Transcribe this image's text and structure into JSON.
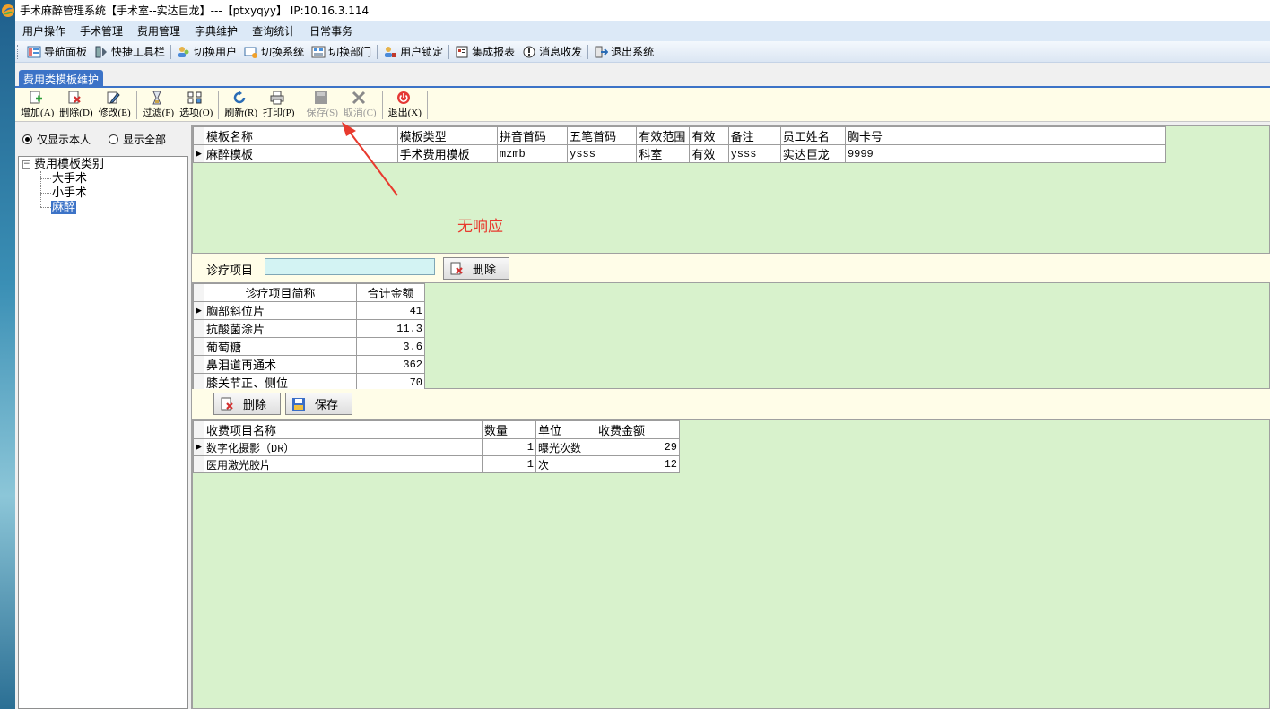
{
  "window": {
    "title": "手术麻醉管理系统【手术室--实达巨龙】---【ptxyqyy】 IP:10.16.3.114"
  },
  "menubar": {
    "items": [
      "用户操作",
      "手术管理",
      "费用管理",
      "字典维护",
      "查询统计",
      "日常事务"
    ]
  },
  "toolbar1": {
    "items": [
      {
        "label": "导航面板",
        "icon": "navigation-panel-icon"
      },
      {
        "label": "快捷工具栏",
        "icon": "quick-toolbar-icon"
      },
      {
        "label": "切换用户",
        "icon": "switch-user-icon"
      },
      {
        "label": "切换系统",
        "icon": "switch-system-icon"
      },
      {
        "label": "切换部门",
        "icon": "switch-department-icon"
      },
      {
        "label": "用户锁定",
        "icon": "user-lock-icon"
      },
      {
        "label": "集成报表",
        "icon": "report-icon"
      },
      {
        "label": "消息收发",
        "icon": "message-icon"
      },
      {
        "label": "退出系统",
        "icon": "exit-system-icon"
      }
    ]
  },
  "tab": {
    "active_label": "费用类模板维护"
  },
  "toolbar2": {
    "add": "增加(A)",
    "delete": "删除(D)",
    "edit": "修改(E)",
    "filter": "过滤(F)",
    "options": "选项(O)",
    "refresh": "刷新(R)",
    "print": "打印(P)",
    "save": "保存(S)",
    "cancel": "取消(C)",
    "exit": "退出(X)"
  },
  "left_panel": {
    "radio_self": "仅显示本人",
    "radio_all": "显示全部",
    "selected_radio": "仅显示本人",
    "tree": {
      "root": "费用模板类别",
      "children": [
        "大手术",
        "小手术",
        "麻醉"
      ],
      "selected": "麻醉"
    }
  },
  "template_grid": {
    "columns": [
      "模板名称",
      "模板类型",
      "拼音首码",
      "五笔首码",
      "有效范围",
      "有效",
      "备注",
      "员工姓名",
      "胸卡号"
    ],
    "rows": [
      [
        "麻醉模板",
        "手术费用模板",
        "mzmb",
        "ysss",
        "科室",
        "有效",
        "ysss",
        "实达巨龙",
        "9999"
      ]
    ]
  },
  "annotation": {
    "text": "无响应",
    "color": "#e83a2e"
  },
  "diagnosis_form": {
    "label": "诊疗项目",
    "input_value": "",
    "delete_button": "删除"
  },
  "diagnosis_grid": {
    "columns": [
      "诊疗项目简称",
      "合计金额"
    ],
    "rows": [
      [
        "胸部斜位片",
        "41"
      ],
      [
        "抗酸菌涂片",
        "11.3"
      ],
      [
        "葡萄糖",
        "3.6"
      ],
      [
        "鼻泪道再通术",
        "362"
      ],
      [
        "膝关节正、侧位",
        "70"
      ]
    ]
  },
  "charge_actions": {
    "delete_button": "删除",
    "save_button": "保存"
  },
  "charge_grid": {
    "columns": [
      "收费项目名称",
      "数量",
      "单位",
      "收费金额"
    ],
    "rows": [
      [
        "数字化摄影（DR）",
        "1",
        "曝光次数",
        "29"
      ],
      [
        "医用激光胶片",
        "1",
        "次",
        "12"
      ]
    ]
  },
  "colors": {
    "grid_background": "#d8f2cc",
    "toolbar_background": "#fffde8",
    "tab_active": "#3c73c7",
    "selection": "#3c73c7"
  }
}
